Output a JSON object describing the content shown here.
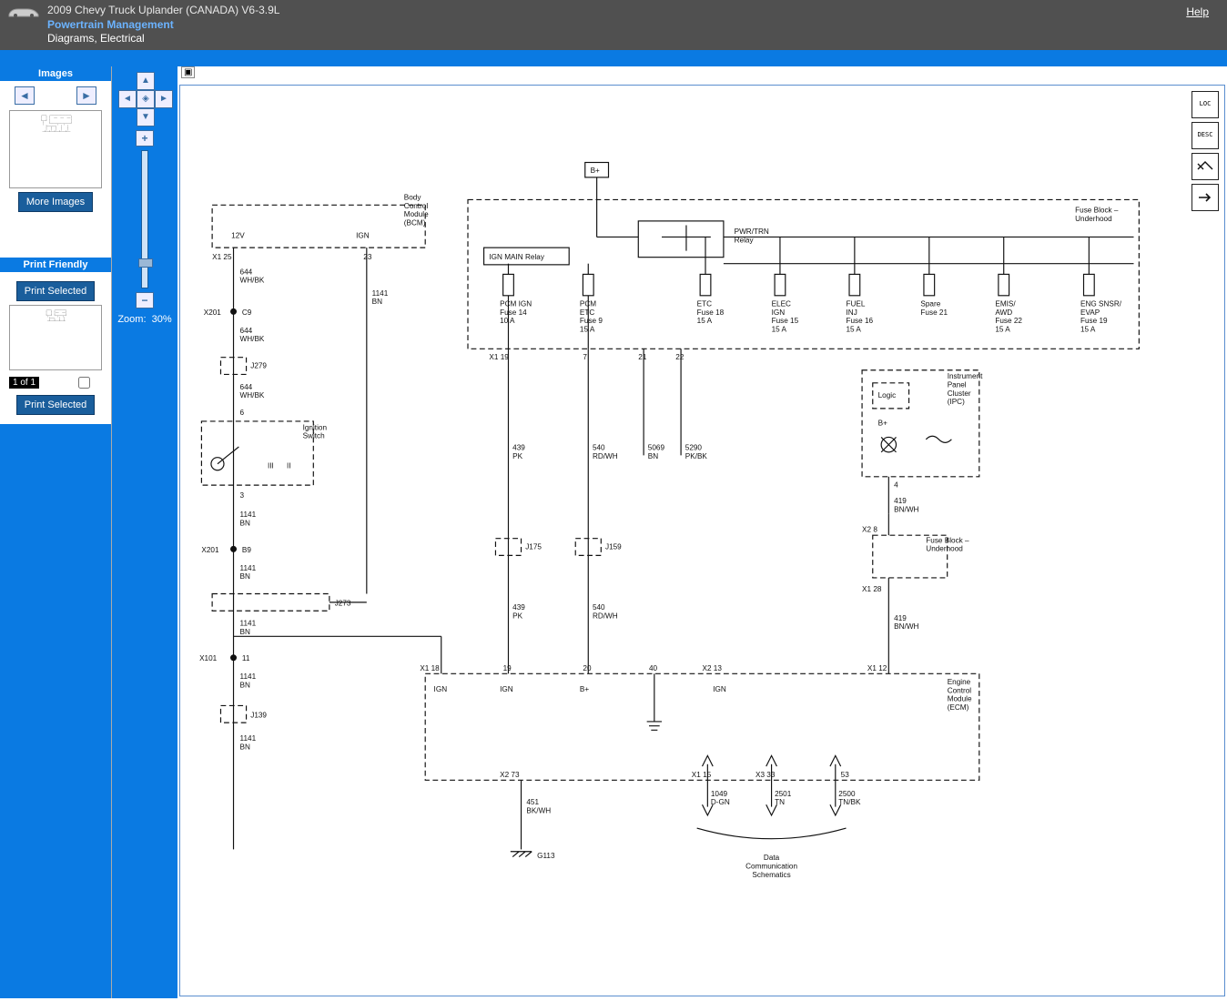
{
  "header": {
    "vehicle": "2009 Chevy Truck Uplander (CANADA) V6-3.9L",
    "section": "Powertrain Management",
    "subsection": "Diagrams, Electrical",
    "help": "Help"
  },
  "sidebar": {
    "images_hdr": "Images",
    "more_images_btn": "More Images",
    "print_friendly_hdr": "Print Friendly",
    "print_selected_btn": "Print Selected",
    "pager_label": "1 of 1"
  },
  "zoom": {
    "label": "Zoom:",
    "value": "30%"
  },
  "corner": {
    "loc": "LOC",
    "desc": "DESC"
  },
  "diagram": {
    "b_plus_top": "B+",
    "bcm": "Body\nControl\nModule\n(BCM)",
    "v12": "12V",
    "ign": "IGN",
    "x1_25": "X1  25",
    "pin23": "23",
    "w644_whbk_a": "644\nWH/BK",
    "w1141_bn_a": "1141\nBN",
    "x201_c9": "X201",
    "c9": "C9",
    "w644_whbk_b": "644\nWH/BK",
    "j279": "J279",
    "w644_whbk_c": "644\nWH/BK",
    "pin6": "6",
    "ign_switch": "Ignition\nSwitch",
    "III": "III",
    "II": "II",
    "pin3": "3",
    "w1141_bn_b": "1141\nBN",
    "x201_b9": "X201",
    "b9": "B9",
    "w1141_bn_c": "1141\nBN",
    "j273": "J273",
    "w1141_bn_d": "1141\nBN",
    "x101_11": "X101",
    "pin11": "11",
    "w1141_bn_e": "1141\nBN",
    "j139": "J139",
    "w1141_bn_f": "1141\nBN",
    "ign_main_relay": "IGN MAIN Relay",
    "pwrtrn_relay": "PWR/TRN\nRelay",
    "fuse_block_top": "Fuse Block –\nUnderhood",
    "pcm_ign": "PCM IGN\nFuse 14\n10 A",
    "pcm_etc": "PCM\nETC\nFuse 9\n15 A",
    "etc": "ETC\nFuse 18\n15 A",
    "elec_ign": "ELEC\nIGN\nFuse 15\n15 A",
    "fuel_inj": "FUEL\nINJ\nFuse 16\n15 A",
    "spare": "Spare\nFuse 21",
    "emis_awd": "EMIS/\nAWD\nFuse 22\n15 A",
    "eng_snsr": "ENG SNSR/\nEVAP\nFuse 19\n15 A",
    "x1_19": "X1  19",
    "pin7": "7",
    "pin21": "21",
    "pin22": "22",
    "w439_pk": "439\nPK",
    "w540_rdwh": "540\nRD/WH",
    "w5069_bn": "5069\nBN",
    "w5290_pkbk": "5290\nPK/BK",
    "j175": "J175",
    "j159": "J159",
    "w439_pk_b": "439\nPK",
    "w540_rdwh_b": "540\nRD/WH",
    "ipc": "Instrument\nPanel\nCluster\n(IPC)",
    "logic": "Logic",
    "b_plus_ipc": "B+",
    "pin4": "4",
    "w419_bnwh_a": "419\nBN/WH",
    "x2_8": "X2  8",
    "fuse_block_mid": "Fuse Block –\nUnderhood",
    "x1_28": "X1  28",
    "w419_bnwh_b": "419\nBN/WH",
    "ecm": "Engine\nControl\nModule\n(ECM)",
    "x1_18": "X1  18",
    "pin19": "19",
    "pin20": "20",
    "pin40": "40",
    "x2_13": "X2  13",
    "x1_12": "X1  12",
    "ecm_ign": "IGN",
    "ecm_ign2": "IGN",
    "ecm_bplus": "B+",
    "ecm_ign3": "IGN",
    "x2_73": "X2  73",
    "w451_bkwh": "451\nBK/WH",
    "g113": "G113",
    "x1_15": "X1  15",
    "x3_33": "X3  33",
    "pin53": "53",
    "w1049": "1049\nD-GN",
    "w2501": "2501\nTN",
    "w2500": "2500\nTN/BK",
    "data_comm": "Data\nCommunication\nSchematics"
  }
}
